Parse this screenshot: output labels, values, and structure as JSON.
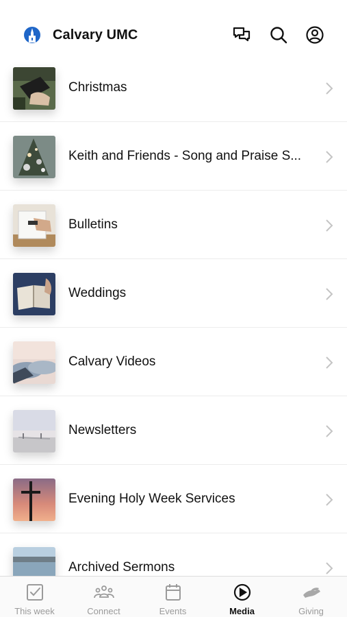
{
  "header": {
    "title": "Calvary UMC",
    "icons": [
      "logo-icon",
      "chat-icon",
      "search-icon",
      "account-icon"
    ]
  },
  "media": {
    "items": [
      {
        "label": "Christmas"
      },
      {
        "label": "Keith and Friends - Song and Praise S..."
      },
      {
        "label": "Bulletins"
      },
      {
        "label": "Weddings"
      },
      {
        "label": "Calvary Videos"
      },
      {
        "label": "Newsletters"
      },
      {
        "label": "Evening Holy Week Services"
      },
      {
        "label": "Archived Sermons"
      }
    ]
  },
  "tabbar": {
    "tabs": [
      {
        "label": "This week",
        "icon": "checkbox-icon"
      },
      {
        "label": "Connect",
        "icon": "people-icon"
      },
      {
        "label": "Events",
        "icon": "calendar-icon"
      },
      {
        "label": "Media",
        "icon": "play-icon",
        "active": true
      },
      {
        "label": "Giving",
        "icon": "hand-icon"
      }
    ]
  },
  "colors": {
    "accent": "#111111",
    "inactive": "#9a9a9a",
    "divider": "#ececec"
  }
}
